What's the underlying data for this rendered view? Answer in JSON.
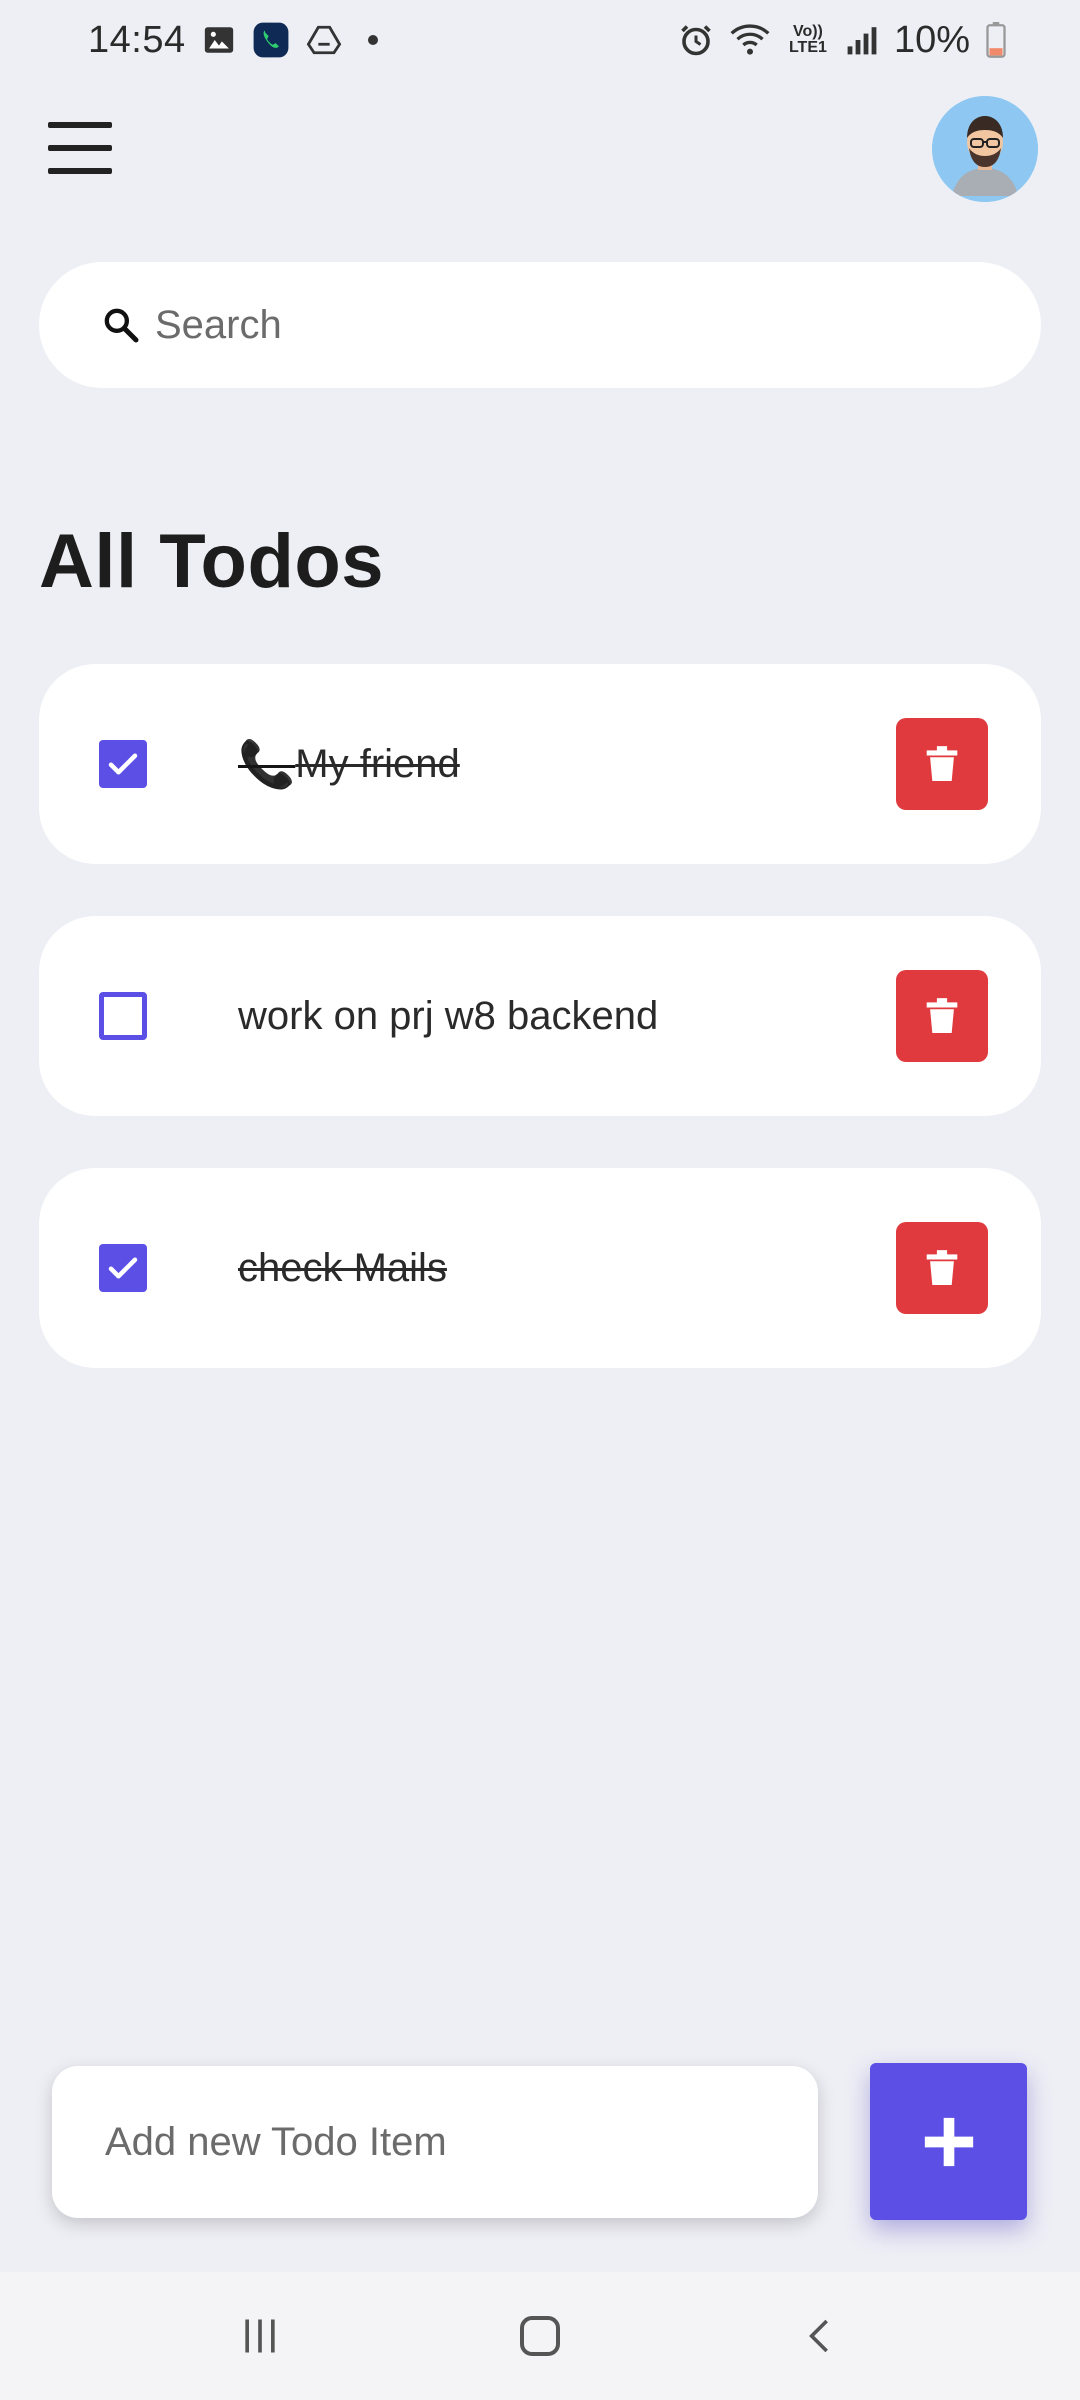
{
  "status_bar": {
    "time": "14:54",
    "battery": "10%",
    "network_label": "Vo)) LTE1"
  },
  "header": {
    "menu_icon": "hamburger-menu-icon",
    "avatar_icon": "user-avatar"
  },
  "search": {
    "placeholder": "Search",
    "value": ""
  },
  "title": "All Todos",
  "todos": [
    {
      "prefix": "📞",
      "text": "My friend",
      "done": true
    },
    {
      "prefix": "",
      "text": "work on prj w8 backend",
      "done": false
    },
    {
      "prefix": "",
      "text": "check Mails",
      "done": true
    }
  ],
  "add_item": {
    "placeholder": "Add new Todo Item",
    "value": "",
    "button_icon": "plus-icon"
  },
  "colors": {
    "background": "#EEEFF5",
    "accent": "#5B4FE6",
    "delete": "#E03A3E",
    "card": "#FFFFFF"
  },
  "nav": {
    "recent_icon": "recent-apps-icon",
    "home_icon": "home-icon",
    "back_icon": "back-icon"
  }
}
